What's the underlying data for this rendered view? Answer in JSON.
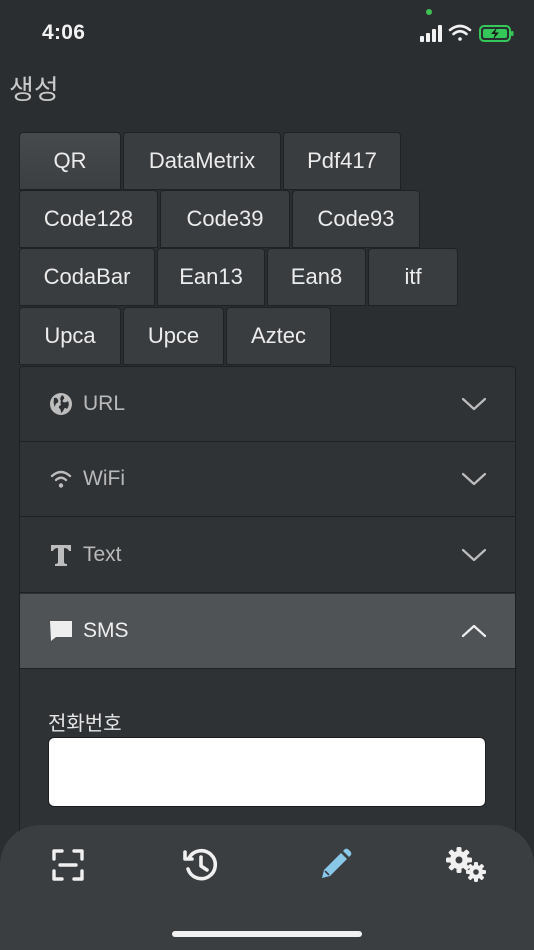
{
  "status": {
    "time": "4:06"
  },
  "header": {
    "title": "생성"
  },
  "barcode_types": {
    "rows": [
      [
        "QR",
        "DataMetrix",
        "Pdf417"
      ],
      [
        "Code128",
        "Code39",
        "Code93"
      ],
      [
        "CodaBar",
        "Ean13",
        "Ean8",
        "itf"
      ],
      [
        "Upca",
        "Upce",
        "Aztec"
      ]
    ],
    "selected": "QR"
  },
  "sections": {
    "url": {
      "label": "URL",
      "icon": "globe-icon"
    },
    "wifi": {
      "label": "WiFi",
      "icon": "wifi-icon"
    },
    "text": {
      "label": "Text",
      "icon": "text-icon"
    },
    "sms": {
      "label": "SMS",
      "icon": "message-icon",
      "expanded": true
    }
  },
  "sms_form": {
    "phone_label": "전화번호",
    "phone_value": ""
  },
  "tabbar": {
    "items": [
      {
        "name": "scan",
        "icon": "scan-icon"
      },
      {
        "name": "history",
        "icon": "history-icon"
      },
      {
        "name": "create",
        "icon": "pencil-icon",
        "active": true
      },
      {
        "name": "settings",
        "icon": "gear-icon"
      }
    ]
  },
  "colors": {
    "active_tab": "#8ac8ea",
    "icon": "#f0f0f0",
    "selected_section": "#505356"
  }
}
